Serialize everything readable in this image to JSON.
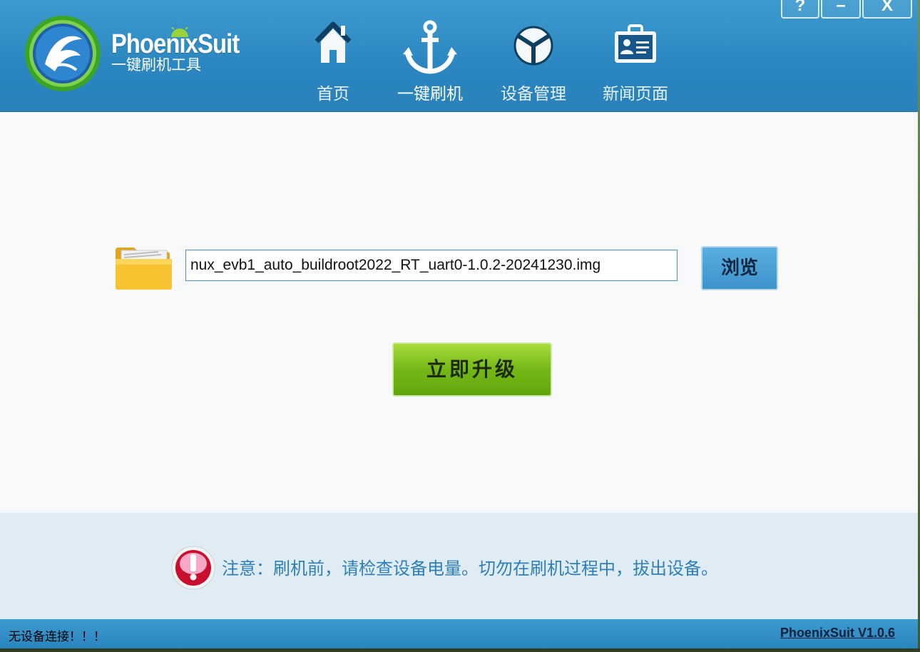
{
  "header": {
    "brand_name": "PhoenixSuit",
    "brand_subtitle": "一键刷机工具",
    "nav": [
      {
        "label": "首页",
        "icon": "home-icon"
      },
      {
        "label": "一键刷机",
        "icon": "anchor-icon"
      },
      {
        "label": "设备管理",
        "icon": "device-manager-icon"
      },
      {
        "label": "新闻页面",
        "icon": "news-icon"
      }
    ],
    "window_controls": {
      "help": "?",
      "minimize": "–",
      "close": "X"
    }
  },
  "main": {
    "file_path": "nux_evb1_auto_buildroot2022_RT_uart0-1.0.2-20241230.img",
    "browse_label": "浏览",
    "upgrade_label": "立即升级"
  },
  "notice": {
    "text": "注意：刷机前，请检查设备电量。切勿在刷机过程中，拔出设备。"
  },
  "status": {
    "left": "无设备连接！！！",
    "right": "PhoenixSuit V1.0.6"
  },
  "colors": {
    "header_blue": "#2b86bf",
    "upgrade_green": "#74b817",
    "notice_text": "#2e7fb8"
  }
}
